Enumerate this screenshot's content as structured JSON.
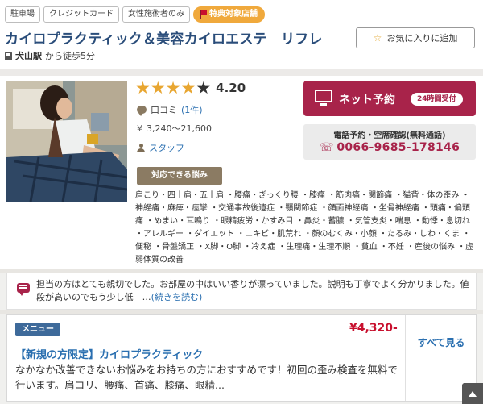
{
  "tags": [
    "駐車場",
    "クレジットカード",
    "女性施術者のみ"
  ],
  "special_tag": "特典対象店舗",
  "shop": {
    "title": "カイロプラクティック＆美容カイロエステ　リフレ",
    "station": "犬山駅",
    "access": "から徒歩5分"
  },
  "favorite_label": "お気に入りに追加",
  "rating": {
    "value": "4.20",
    "stars": 4,
    "max": 5
  },
  "reviews": {
    "label": "口コミ",
    "count": "(1件)"
  },
  "price_range": "3,240〜21,600",
  "staff_label": "スタッフ",
  "net_booking": {
    "label": "ネット予約",
    "hours": "24時間受付"
  },
  "phone": {
    "label": "電話予約・空席確認(無料通話)",
    "number": "0066-9685-178146"
  },
  "concerns": {
    "button": "対応できる悩み",
    "text": "肩こり・四十肩・五十肩 ・腰痛・ぎっくり腰 ・膝痛 ・筋肉痛・関節痛 ・猫背・体の歪み ・神経痛・麻痺・痙攣 ・交通事故後遺症 ・顎関節症 ・顔面神経痛 ・坐骨神経痛 ・頭痛・偏頭痛 ・めまい・耳鳴り ・眼精疲労・かすみ目 ・鼻炎・蓄膿 ・気管支炎・喘息 ・動悸・息切れ ・アレルギー ・ダイエット ・ニキビ・肌荒れ ・顔のむくみ・小顔 ・たるみ・しわ・くま ・便秘 ・骨盤矯正 ・X脚・O脚 ・冷え症 ・生理痛・生理不順 ・貧血 ・不妊 ・産後の悩み ・虚弱体質の改善"
  },
  "comment": {
    "text": "担当の方はとても親切でした。お部屋の中はいい香りが漂っていました。説明も丁寧でよく分かりました。値段が高いのでもう少し低　…",
    "read_more": "(続きを読む)"
  },
  "menu": {
    "badge": "メニュー",
    "price": "¥4,320-",
    "title": "【新規の方限定】カイロプラクティック",
    "description": "なかなか改善できないお悩みをお持ちの方におすすめです！初回の歪み検査を無料で行います。肩コリ、腰痛、首痛、膝痛、眼精...",
    "see_all": "すべて見る"
  },
  "colors": {
    "brand": "#a8234a",
    "title": "#2a4d7a",
    "star": "#e8a631",
    "tag_special": "#f0a93c",
    "menu_badge": "#3e6a9a"
  }
}
